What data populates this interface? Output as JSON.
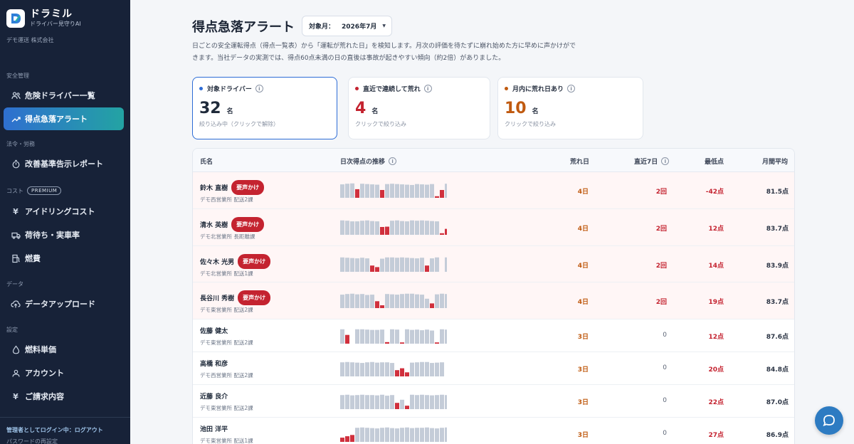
{
  "app": {
    "name": "ドラミル",
    "tagline": "ドライバー見守りAI",
    "company": "デモ運送 株式会社"
  },
  "sidebar": {
    "sections": [
      {
        "label": "安全管理"
      },
      {
        "label": "法令・労務"
      },
      {
        "label": "コスト",
        "badge": "PREMIUM"
      },
      {
        "label": "データ"
      },
      {
        "label": "設定"
      }
    ],
    "items": [
      {
        "label": "危険ドライバー一覧",
        "icon": "users-icon",
        "active": false
      },
      {
        "label": "得点急落アラート",
        "icon": "trend-icon",
        "active": true
      },
      {
        "label": "改善基準告示レポート",
        "icon": "stopwatch-icon",
        "active": false
      },
      {
        "label": "アイドリングコスト",
        "icon": "yen-icon",
        "active": false
      },
      {
        "label": "荷待ち・実車率",
        "icon": "truck-icon",
        "active": false
      },
      {
        "label": "燃費",
        "icon": "fuel-icon",
        "active": false
      },
      {
        "label": "データアップロード",
        "icon": "cloud-upload-icon",
        "active": false
      },
      {
        "label": "燃料単価",
        "icon": "drop-icon",
        "active": false
      },
      {
        "label": "アカウント",
        "icon": "user-icon",
        "active": false
      },
      {
        "label": "ご請求内容",
        "icon": "yen-icon",
        "active": false
      }
    ],
    "login_info": "管理者としてログイン中：ログアウト",
    "password_reset": "パスワードの再設定"
  },
  "header": {
    "title": "得点急落アラート",
    "month_label": "対象月：",
    "month_value": "2026年7月",
    "description": "日ごとの安全運転得点（得点一覧表）から「運転が荒れた日」を検知します。月次の評価を待たずに崩れ始めた方に早めに声かけができます。当社データの実測では、得点60点未満の日の直後は事故が起きやすい傾向（約2倍）がありました。"
  },
  "cards": [
    {
      "title": "対象ドライバー",
      "value": "32",
      "unit": "名",
      "hint": "絞り込み中（クリックで解除）",
      "color": "#2d6cd6",
      "selected": true
    },
    {
      "title": "直近で連続して荒れ",
      "value": "4",
      "unit": "名",
      "hint": "クリックで絞り込み",
      "color": "#c42330",
      "selected": false
    },
    {
      "title": "月内に荒れ日あり",
      "value": "10",
      "unit": "名",
      "hint": "クリックで絞り込み",
      "color": "#c05a10",
      "selected": false
    }
  ],
  "table": {
    "columns": {
      "name": "氏名",
      "trend": "日次得点の推移",
      "rough_days": "荒れ日",
      "recent7": "直近7日",
      "min": "最低点",
      "avg": "月間平均"
    },
    "rows": [
      {
        "name": "鈴木 直樹",
        "badge": "要声かけ",
        "office": "デモ西営業所 配送2課",
        "rough_days": "4日",
        "recent7": "2回",
        "min": "-42点",
        "avg": "81.5点",
        "trend": [
          86,
          90,
          92,
          55,
          90,
          88,
          86,
          84,
          50,
          88,
          90,
          88,
          86,
          84,
          82,
          88,
          86,
          84,
          88,
          10,
          50,
          90,
          92
        ]
      },
      {
        "name": "清水 英樹",
        "badge": "要声かけ",
        "office": "デモ北営業所 長距離課",
        "rough_days": "4日",
        "recent7": "2回",
        "min": "12点",
        "avg": "83.7点",
        "trend": [
          92,
          90,
          86,
          86,
          90,
          92,
          88,
          86,
          50,
          52,
          90,
          92,
          88,
          86,
          92,
          90,
          92,
          90,
          88,
          86,
          10,
          38,
          0
        ]
      },
      {
        "name": "佐々木 光男",
        "badge": "要声かけ",
        "office": "デモ北営業所 配送1課",
        "rough_days": "4日",
        "recent7": "2回",
        "min": "14点",
        "avg": "83.9点",
        "trend": [
          92,
          90,
          88,
          86,
          90,
          86,
          40,
          30,
          84,
          92,
          92,
          90,
          92,
          90,
          88,
          86,
          90,
          40,
          86,
          92,
          0,
          92,
          86
        ]
      },
      {
        "name": "長谷川 秀樹",
        "badge": "要声かけ",
        "office": "デモ東営業所 配送2課",
        "rough_days": "4日",
        "recent7": "2回",
        "min": "19点",
        "avg": "83.7点",
        "trend": [
          86,
          90,
          92,
          88,
          90,
          84,
          86,
          44,
          18,
          90,
          88,
          86,
          90,
          92,
          92,
          88,
          86,
          60,
          30,
          88,
          92,
          90,
          0
        ]
      },
      {
        "name": "佐藤 健太",
        "badge": "",
        "office": "デモ東営業所 配送2課",
        "rough_days": "3日",
        "recent7": "0",
        "min": "12点",
        "avg": "87.6点",
        "trend": [
          92,
          56,
          0,
          92,
          92,
          90,
          88,
          88,
          90,
          10,
          92,
          90,
          8,
          92,
          88,
          90,
          86,
          90,
          84,
          8,
          92,
          90,
          92
        ]
      },
      {
        "name": "高橋 和彦",
        "badge": "",
        "office": "デモ西営業所 配送2課",
        "rough_days": "3日",
        "recent7": "0",
        "min": "20点",
        "avg": "84.8点",
        "trend": [
          90,
          92,
          90,
          88,
          86,
          90,
          92,
          88,
          90,
          90,
          86,
          40,
          52,
          26,
          88,
          90,
          92,
          92,
          86,
          88,
          90,
          0,
          0
        ]
      },
      {
        "name": "近藤 良介",
        "badge": "",
        "office": "デモ東営業所 配送2課",
        "rough_days": "3日",
        "recent7": "0",
        "min": "22点",
        "avg": "87.0点",
        "trend": [
          90,
          92,
          88,
          90,
          92,
          90,
          90,
          88,
          92,
          86,
          90,
          40,
          60,
          22,
          92,
          90,
          92,
          90,
          88,
          90,
          92,
          90,
          92
        ]
      },
      {
        "name": "池田 洋平",
        "badge": "",
        "office": "デモ東営業所 配送1課",
        "rough_days": "3日",
        "recent7": "0",
        "min": "27点",
        "avg": "86.9点",
        "trend": [
          27,
          36,
          44,
          90,
          92,
          90,
          88,
          86,
          90,
          92,
          88,
          86,
          90,
          92,
          88,
          90,
          90,
          92,
          88,
          86,
          90,
          92,
          88
        ]
      }
    ]
  },
  "colors": {
    "accent": "#2d6cd6",
    "alert": "#c42330",
    "warning": "#c05a10",
    "bar_normal": "#c4ccd8",
    "bar_rough": "#d0303d"
  }
}
